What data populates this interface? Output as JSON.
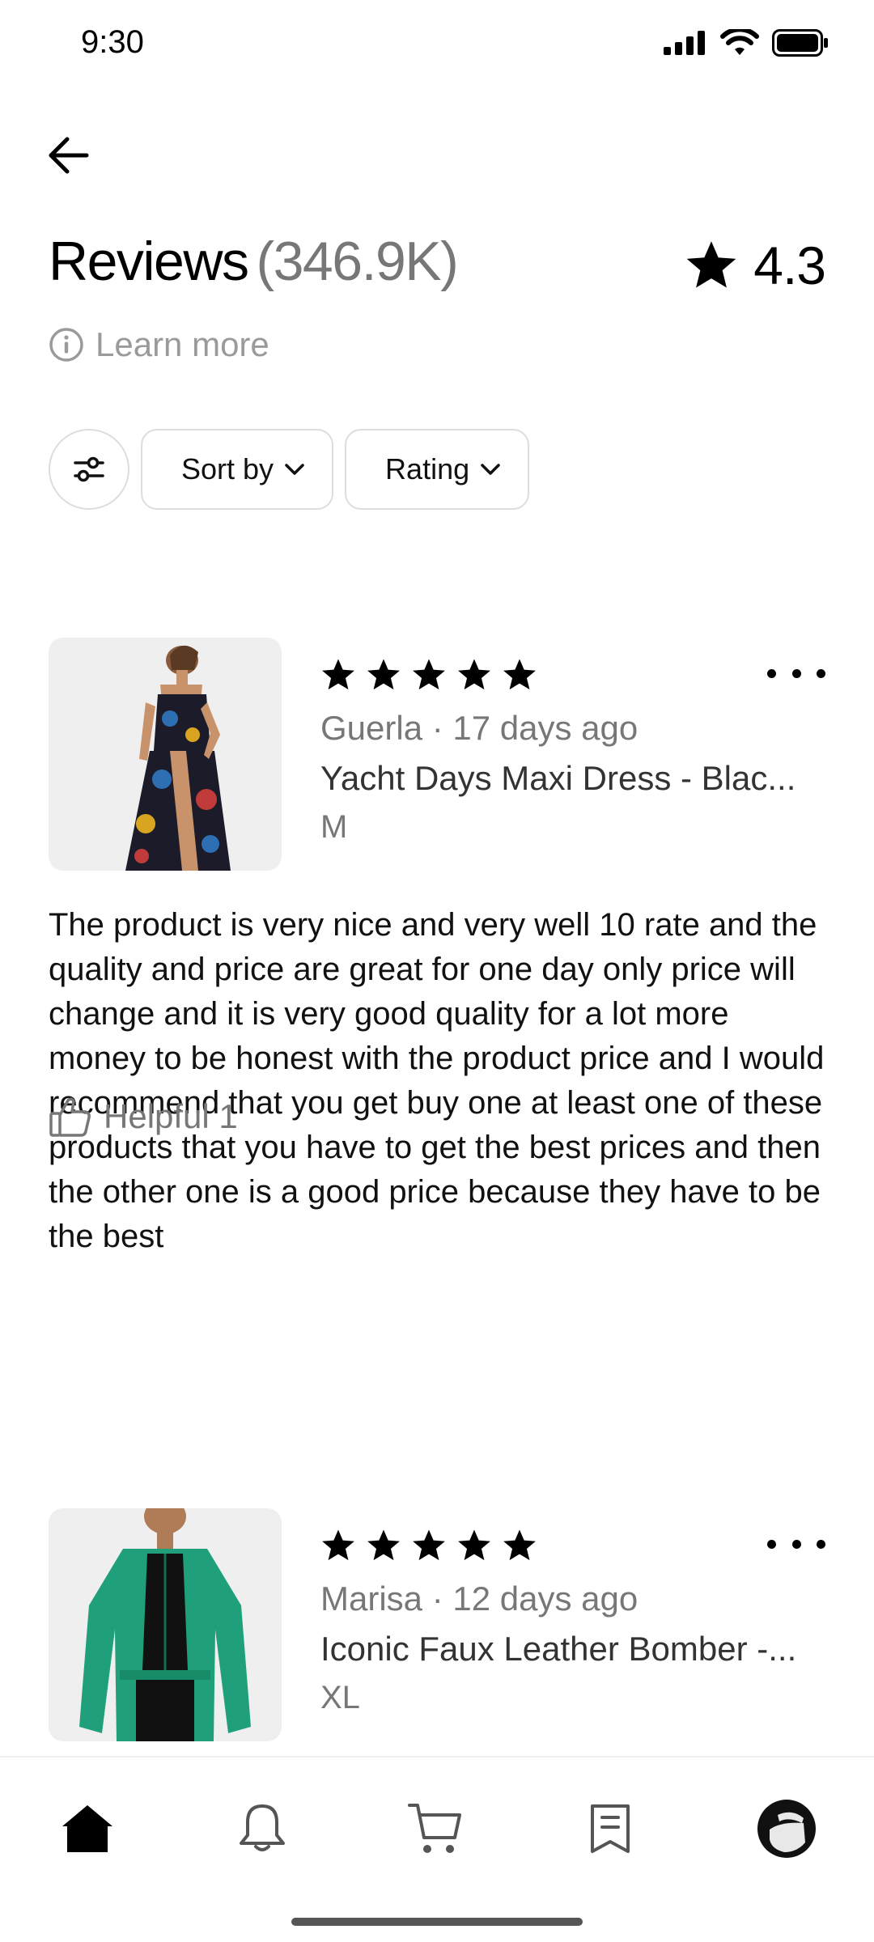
{
  "status_bar": {
    "time": "9:30"
  },
  "header": {
    "title": "Reviews",
    "count": "(346.9K)",
    "rating": "4.3"
  },
  "learn_more": {
    "label": "Learn more"
  },
  "filters": {
    "sort_label": "Sort by",
    "rating_label": "Rating"
  },
  "reviews": [
    {
      "stars": 5,
      "reviewer": "Guerla · 17 days ago",
      "product": "Yacht Days Maxi Dress - Blac...",
      "size": "M",
      "body": "The product is very nice and very well 10 rate and the quality and price are great for one day only price will change and it is very good quality for a lot more money to be honest with the product price and I would recommend that you get buy one at least one of these products that you have to get the best prices and then the other one is a good price because they have to be the best",
      "helpful": "Helpful 1"
    },
    {
      "stars": 5,
      "reviewer": "Marisa · 12 days ago",
      "product": "Iconic Faux Leather Bomber -...",
      "size": "XL"
    }
  ],
  "colors": {
    "dress_print": "#1b1b2a",
    "jacket_green": "#1fa07a"
  }
}
